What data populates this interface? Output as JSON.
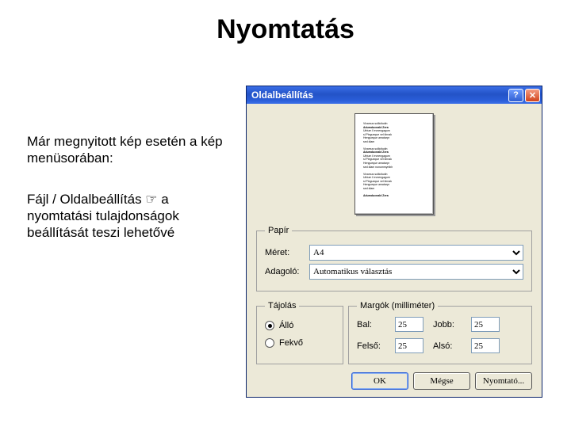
{
  "slide": {
    "title": "Nyomtatás",
    "para1": "Már megnyitott kép esetén a kép menüsorában:",
    "para2_pre": "Fájl / Oldalbeállítás ",
    "para2_arrow": "☞",
    "para2_post": " a nyomtatási tulajdonságok beállítását teszi lehetővé"
  },
  "dialog": {
    "title": "Oldalbeállítás",
    "help_glyph": "?",
    "close_glyph": "✕",
    "paper": {
      "legend": "Papír",
      "size_label": "Méret:",
      "size_value": "A4",
      "source_label": "Adagoló:",
      "source_value": "Automatikus választás"
    },
    "orientation": {
      "legend": "Tájolás",
      "portrait_label": "Álló",
      "landscape_label": "Fekvő",
      "selected": "portrait"
    },
    "margins": {
      "legend": "Margók (milliméter)",
      "left_label": "Bal:",
      "right_label": "Jobb:",
      "top_label": "Felső:",
      "bottom_label": "Alsó:",
      "left": "25",
      "right": "25",
      "top": "25",
      "bottom": "25"
    },
    "buttons": {
      "ok": "OK",
      "cancel": "Mégse",
      "printer": "Nyomtató..."
    }
  }
}
